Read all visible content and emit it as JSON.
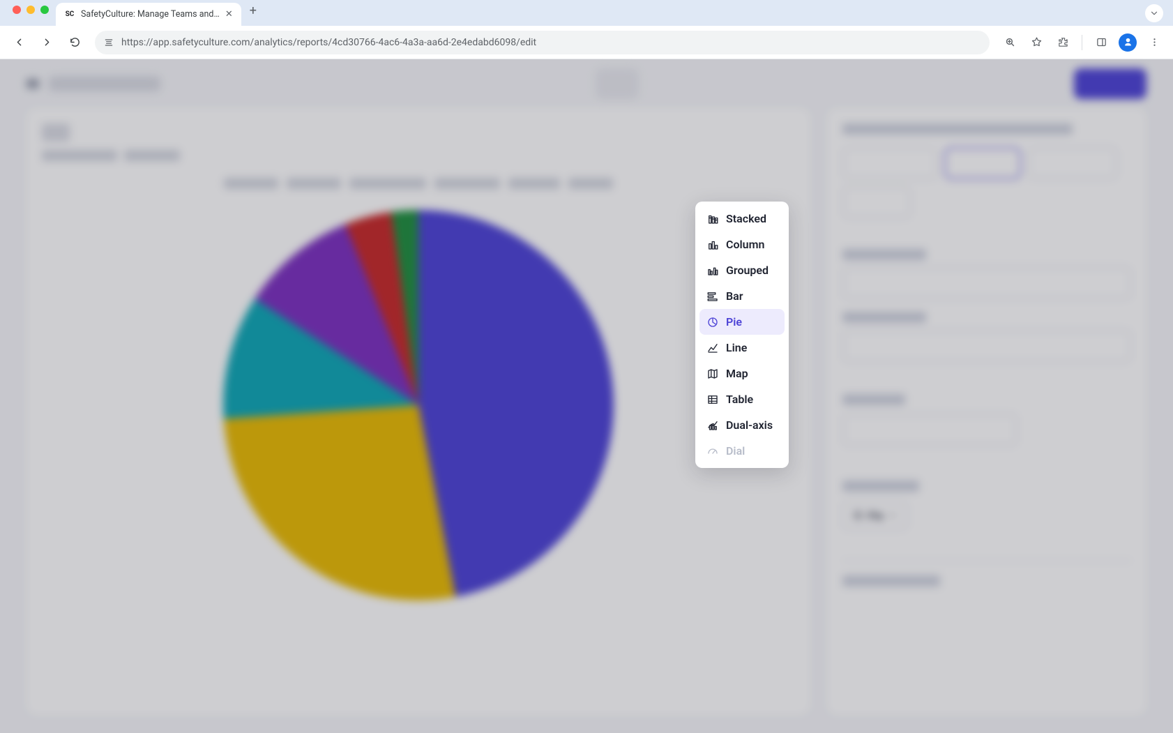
{
  "browser": {
    "tab_title": "SafetyCulture: Manage Teams and…",
    "url": "https://app.safetyculture.com/analytics/reports/4cd30766-4ac6-4a3a-aa6d-2e4edabd6098/edit"
  },
  "chart_type_menu": {
    "items": [
      {
        "key": "stacked",
        "label": "Stacked",
        "icon": "stacked-bar-icon",
        "selected": false,
        "disabled": false
      },
      {
        "key": "column",
        "label": "Column",
        "icon": "column-chart-icon",
        "selected": false,
        "disabled": false
      },
      {
        "key": "grouped",
        "label": "Grouped",
        "icon": "grouped-bar-icon",
        "selected": false,
        "disabled": false
      },
      {
        "key": "bar",
        "label": "Bar",
        "icon": "bar-chart-icon",
        "selected": false,
        "disabled": false
      },
      {
        "key": "pie",
        "label": "Pie",
        "icon": "pie-chart-icon",
        "selected": true,
        "disabled": false
      },
      {
        "key": "line",
        "label": "Line",
        "icon": "line-chart-icon",
        "selected": false,
        "disabled": false
      },
      {
        "key": "map",
        "label": "Map",
        "icon": "map-icon",
        "selected": false,
        "disabled": false
      },
      {
        "key": "table",
        "label": "Table",
        "icon": "table-icon",
        "selected": false,
        "disabled": false
      },
      {
        "key": "dualaxis",
        "label": "Dual-axis",
        "icon": "dual-axis-icon",
        "selected": false,
        "disabled": false
      },
      {
        "key": "dial",
        "label": "Dial",
        "icon": "dial-icon",
        "selected": false,
        "disabled": true
      }
    ]
  },
  "side_panel": {
    "current_chart_chip": "Pie"
  },
  "chart_data": {
    "type": "pie",
    "title": "",
    "series": [
      {
        "name": "Slice 1",
        "value": 47,
        "color": "#4c42d6"
      },
      {
        "name": "Slice 2",
        "value": 27,
        "color": "#e8ba02"
      },
      {
        "name": "Slice 3",
        "value": 10,
        "color": "#0da7b6"
      },
      {
        "name": "Slice 4",
        "value": 10,
        "color": "#7b2fbf"
      },
      {
        "name": "Slice 5",
        "value": 4,
        "color": "#c62828"
      },
      {
        "name": "Slice 6",
        "value": 2,
        "color": "#1e8e3e"
      }
    ],
    "note": "Legend labels and numeric data labels are obscured/blurred in the screenshot; percentages estimated from slice angles."
  }
}
